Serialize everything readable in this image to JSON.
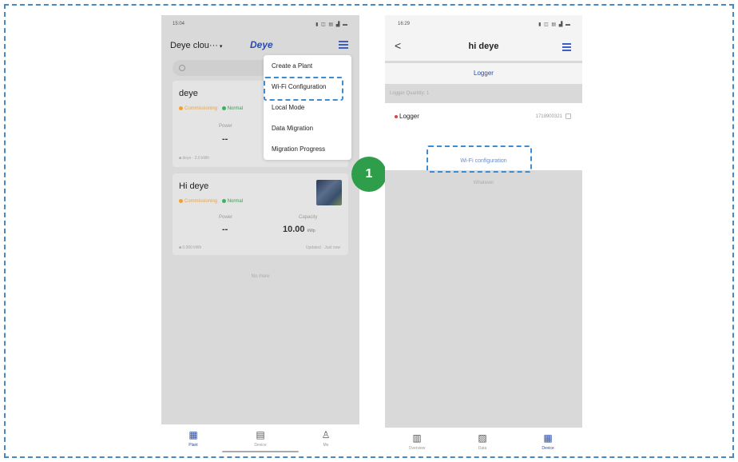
{
  "step_number": "1",
  "colors": {
    "accent": "#2a4aa5",
    "highlight": "#3f8bd0",
    "step_badge": "#2e9e4a",
    "online_green": "#3cb35b",
    "status_orange": "#f2a12c"
  },
  "screen1": {
    "status_time": "15:04",
    "status_icons": "▮ ◫ ▤ ▟ ▬",
    "account_title": "Deye clou···",
    "caret": "▾",
    "logo": "Deye",
    "menu": {
      "items": [
        {
          "label": "Create a Plant"
        },
        {
          "label": "Wi-Fi Configuration"
        },
        {
          "label": "Local Mode"
        },
        {
          "label": "Data Migration"
        },
        {
          "label": "Migration Progress"
        }
      ]
    },
    "plants": [
      {
        "name": "deye",
        "status": "Commissioning",
        "online": "Normal",
        "power_label": "Power",
        "power_value": "--",
        "footer_left": "■ deye · 2.0 kWh"
      },
      {
        "name": "Hi deye",
        "status": "Commissioning",
        "online": "Normal",
        "power_label": "Power",
        "power_value": "--",
        "capacity_label": "Capacity",
        "capacity_value": "10.00",
        "capacity_unit": "kWp",
        "footer_left": "■ 0.000 kWh",
        "footer_right": "Updated · Just now"
      }
    ],
    "no_more": "No more",
    "tabs": [
      {
        "label": "Plant",
        "icon": "plant-icon",
        "glyph": "▦"
      },
      {
        "label": "Device",
        "icon": "calendar-icon",
        "glyph": "▤"
      },
      {
        "label": "Me",
        "icon": "person-icon",
        "glyph": "♙"
      }
    ]
  },
  "screen2": {
    "status_time": "16:29",
    "status_icons": "▮ ◫ ▤ ▟ ▬",
    "back_glyph": "<",
    "title": "hi deye",
    "tab_label": "Logger",
    "section_label": "Logger Quantity: 1",
    "logger": {
      "name": "Logger",
      "serial": "1718900321",
      "action_label": "Wi-Fi configuration"
    },
    "under_label": "Whatever",
    "tabs": [
      {
        "label": "Overview",
        "icon": "document-icon",
        "glyph": "▥"
      },
      {
        "label": "Data",
        "icon": "image-icon",
        "glyph": "▨"
      },
      {
        "label": "Device",
        "icon": "device-icon",
        "glyph": "▦"
      }
    ]
  }
}
